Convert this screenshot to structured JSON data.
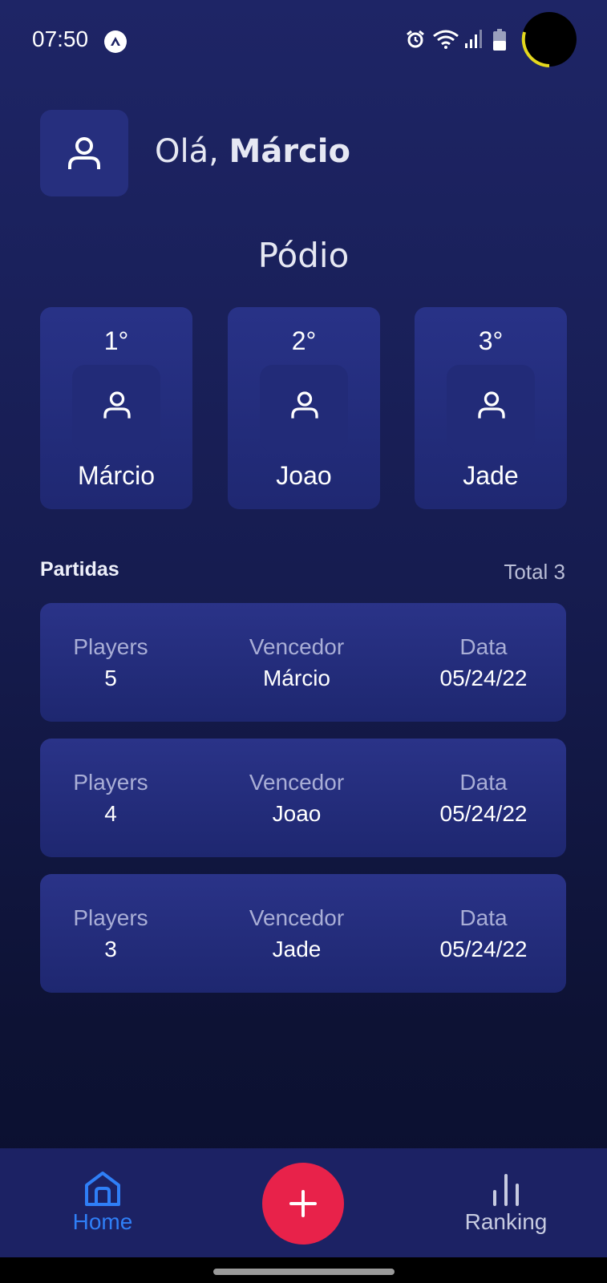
{
  "status_bar": {
    "time": "07:50",
    "icons": [
      "app-notification-icon",
      "alarm-icon",
      "wifi-icon",
      "signal-icon",
      "battery-icon"
    ]
  },
  "header": {
    "greeting_prefix": "Olá, ",
    "user_name": "Márcio",
    "avatar_icon": "user-icon"
  },
  "podium": {
    "title": "Pódio",
    "entries": [
      {
        "place": "1°",
        "name": "Márcio",
        "icon": "user-icon"
      },
      {
        "place": "2°",
        "name": "Joao",
        "icon": "user-icon"
      },
      {
        "place": "3°",
        "name": "Jade",
        "icon": "user-icon"
      }
    ]
  },
  "matches": {
    "heading": "Partidas",
    "total": "Total 3",
    "labels": {
      "players": "Players",
      "winner": "Vencedor",
      "date": "Data"
    },
    "items": [
      {
        "players": "5",
        "winner": "Márcio",
        "date": "05/24/22"
      },
      {
        "players": "4",
        "winner": "Joao",
        "date": "05/24/22"
      },
      {
        "players": "3",
        "winner": "Jade",
        "date": "05/24/22"
      }
    ]
  },
  "bottom_nav": {
    "home_label": "Home",
    "ranking_label": "Ranking",
    "add_icon": "plus-icon",
    "active_tab": "home"
  },
  "colors": {
    "background_top": "#1e2566",
    "background_bottom": "#0b0f2e",
    "card": "#262f7e",
    "accent_active": "#2f7ff7",
    "add_button": "#e8224a",
    "camera_ring": "#e4d81e"
  }
}
